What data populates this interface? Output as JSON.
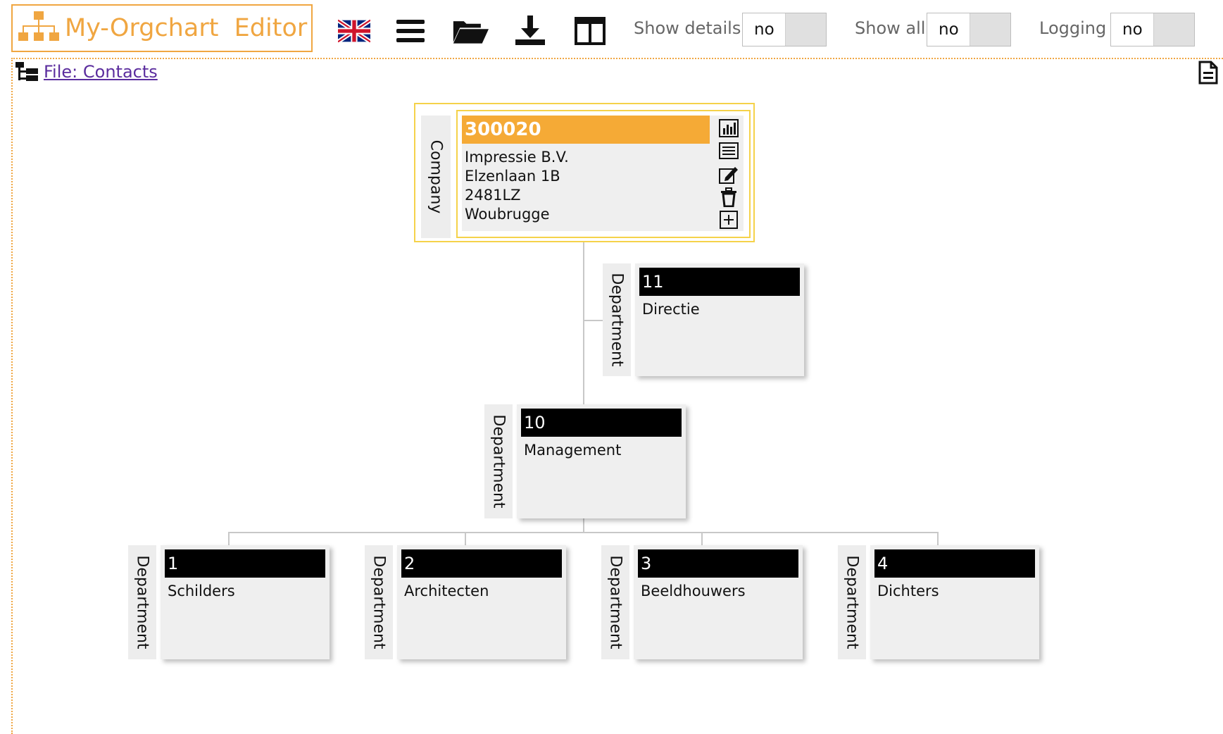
{
  "app": {
    "title": "My-Orgchart  Editor",
    "accent_color": "#f0a641"
  },
  "toolbar": {
    "buttons": [
      {
        "name": "uk-flag-icon"
      },
      {
        "name": "menu-icon"
      },
      {
        "name": "folder-open-icon"
      },
      {
        "name": "download-icon"
      },
      {
        "name": "layout-icon"
      }
    ],
    "show_details": {
      "label": "Show details",
      "value": "no"
    },
    "show_all": {
      "label": "Show all",
      "value": "no"
    },
    "logging": {
      "label": "Logging",
      "value": "no"
    }
  },
  "file": {
    "link_text": "File: Contacts"
  },
  "company": {
    "type": "Company",
    "id": "300020",
    "lines": [
      "Impressie B.V.",
      "Elzenlaan 1B",
      "2481LZ",
      "Woubrugge"
    ],
    "header_color": "#f5aa36",
    "actions": [
      "chart-icon",
      "list-icon",
      "edit-icon",
      "trash-icon",
      "add-icon"
    ]
  },
  "departments": [
    {
      "type": "Department",
      "id": "11",
      "name": "Directie"
    },
    {
      "type": "Department",
      "id": "10",
      "name": "Management"
    },
    {
      "type": "Department",
      "id": "1",
      "name": "Schilders"
    },
    {
      "type": "Department",
      "id": "2",
      "name": "Architecten"
    },
    {
      "type": "Department",
      "id": "3",
      "name": "Beeldhouwers"
    },
    {
      "type": "Department",
      "id": "4",
      "name": "Dichters"
    }
  ]
}
